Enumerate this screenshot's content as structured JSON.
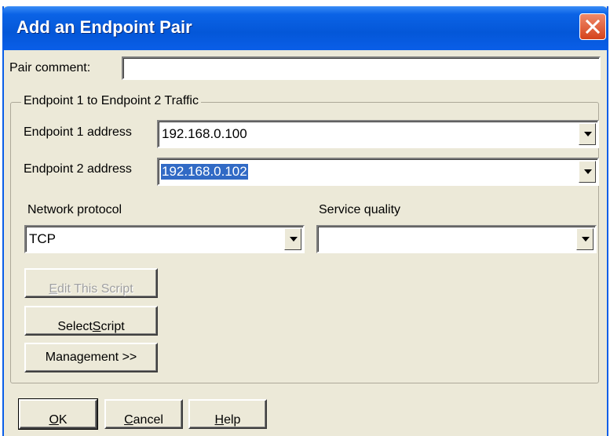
{
  "dialog": {
    "title": "Add an Endpoint Pair",
    "pair_comment": {
      "label": "Pair comment:",
      "value": ""
    },
    "traffic_group": {
      "title": "Endpoint 1 to Endpoint 2 Traffic",
      "endpoint1": {
        "label": "Endpoint 1 address",
        "value": "192.168.0.100"
      },
      "endpoint2": {
        "label": "Endpoint 2 address",
        "value": "192.168.0.102"
      },
      "network_protocol": {
        "label": "Network protocol",
        "value": "TCP"
      },
      "service_quality": {
        "label": "Service quality",
        "value": ""
      },
      "edit_script": {
        "pre": "",
        "mnemonic": "E",
        "post": "dit This Script"
      },
      "select_script": {
        "pre": "Select ",
        "mnemonic": "S",
        "post": "cript"
      },
      "management": {
        "label": "Management >>"
      }
    },
    "ok": {
      "pre": "",
      "mnemonic": "O",
      "post": "K"
    },
    "cancel": {
      "pre": "",
      "mnemonic": "C",
      "post": "ancel"
    },
    "help": {
      "pre": "",
      "mnemonic": "H",
      "post": "elp"
    }
  },
  "colors": {
    "titlebar": "#0a5ee8",
    "dialog_bg": "#ece9d8",
    "selection": "#316ac5",
    "close_button": "#d4431c"
  },
  "icons": {
    "close": "close-x-icon",
    "dropdown": "chevron-down-icon"
  }
}
